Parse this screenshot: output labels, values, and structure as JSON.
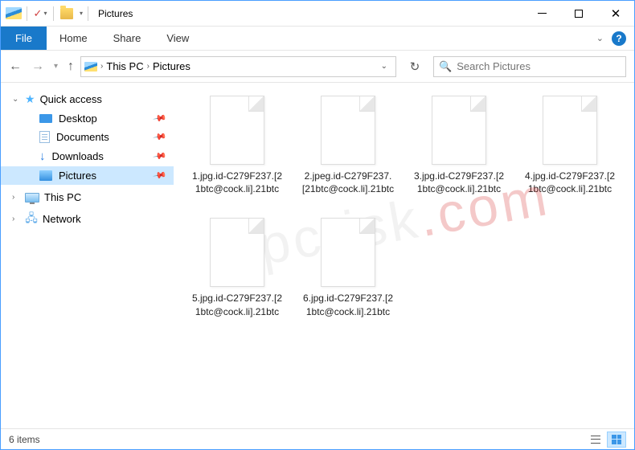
{
  "window": {
    "title": "Pictures"
  },
  "ribbon": {
    "file": "File",
    "tabs": [
      "Home",
      "Share",
      "View"
    ]
  },
  "breadcrumb": {
    "segments": [
      "This PC",
      "Pictures"
    ]
  },
  "search": {
    "placeholder": "Search Pictures"
  },
  "sidebar": {
    "quick_access": "Quick access",
    "items": [
      {
        "label": "Desktop",
        "pinned": true
      },
      {
        "label": "Documents",
        "pinned": true
      },
      {
        "label": "Downloads",
        "pinned": true
      },
      {
        "label": "Pictures",
        "pinned": true,
        "selected": true
      }
    ],
    "this_pc": "This PC",
    "network": "Network"
  },
  "files": [
    {
      "name": "1.jpg.id-C279F237.[21btc@cock.li].21btc"
    },
    {
      "name": "2.jpeg.id-C279F237.[21btc@cock.li].21btc"
    },
    {
      "name": "3.jpg.id-C279F237.[21btc@cock.li].21btc"
    },
    {
      "name": "4.jpg.id-C279F237.[21btc@cock.li].21btc"
    },
    {
      "name": "5.jpg.id-C279F237.[21btc@cock.li].21btc"
    },
    {
      "name": "6.jpg.id-C279F237.[21btc@cock.li].21btc"
    }
  ],
  "status": {
    "count_label": "6 items"
  },
  "watermark": {
    "a": "pcrisk",
    "b": ".com"
  }
}
